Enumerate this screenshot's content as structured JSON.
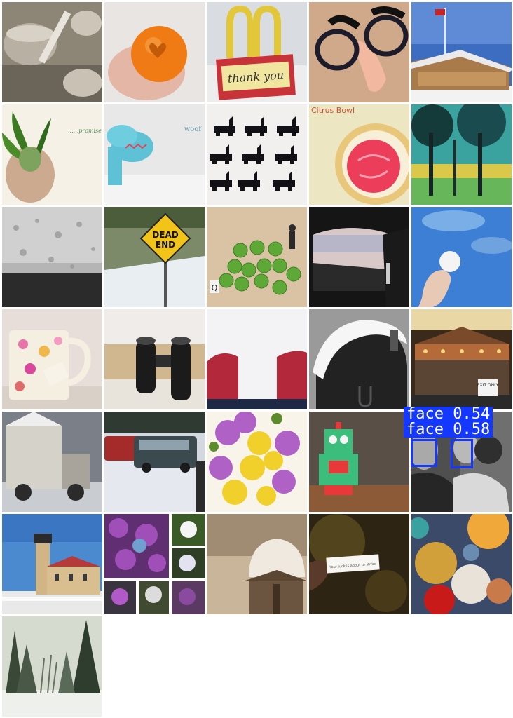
{
  "grid": {
    "tiles": [
      {
        "name": "baking-brush-photo"
      },
      {
        "name": "orange-heart-photo"
      },
      {
        "name": "mcdonalds-thank-you-sign-photo",
        "sign_text": "thank you"
      },
      {
        "name": "groucho-glasses-photo"
      },
      {
        "name": "flag-lodge-photo"
      },
      {
        "name": "hyacinth-bulb-photo",
        "caption": "......promise"
      },
      {
        "name": "blue-toy-dog-photo",
        "caption": "woof"
      },
      {
        "name": "black-scottie-candies-photo"
      },
      {
        "name": "citrus-bowl-photo",
        "caption": "Citrus Bowl"
      },
      {
        "name": "tinted-trees-photo"
      },
      {
        "name": "rainy-window-photo"
      },
      {
        "name": "dead-end-sign-photo",
        "sign_line1": "DEAD",
        "sign_line2": "END"
      },
      {
        "name": "green-peas-figurine-photo",
        "letter": "Q"
      },
      {
        "name": "car-mirror-photo"
      },
      {
        "name": "cotton-ball-sky-photo"
      },
      {
        "name": "floral-mug-photo"
      },
      {
        "name": "binoculars-photo"
      },
      {
        "name": "red-boots-snow-photo"
      },
      {
        "name": "snowy-mailbox-photo"
      },
      {
        "name": "carousel-photo",
        "sign_text": "EXIT ONLY"
      },
      {
        "name": "snow-plow-truck-photo"
      },
      {
        "name": "snowy-parking-lot-photo"
      },
      {
        "name": "yellow-purple-flowers-photo"
      },
      {
        "name": "green-robot-toy-photo"
      },
      {
        "name": "mother-child-photo"
      },
      {
        "name": "lighthouse-photo"
      },
      {
        "name": "flower-collage-photo"
      },
      {
        "name": "snow-birdhouse-photo"
      },
      {
        "name": "fortune-cookie-photo",
        "slip_text": "Your luck is about to strike"
      },
      {
        "name": "colorful-bubbles-photo"
      },
      {
        "name": "snowy-forest-photo"
      }
    ]
  },
  "detections": [
    {
      "label": "face 0.54"
    },
    {
      "label": "face 0.58"
    }
  ],
  "colors": {
    "detection": "#1438ff"
  }
}
